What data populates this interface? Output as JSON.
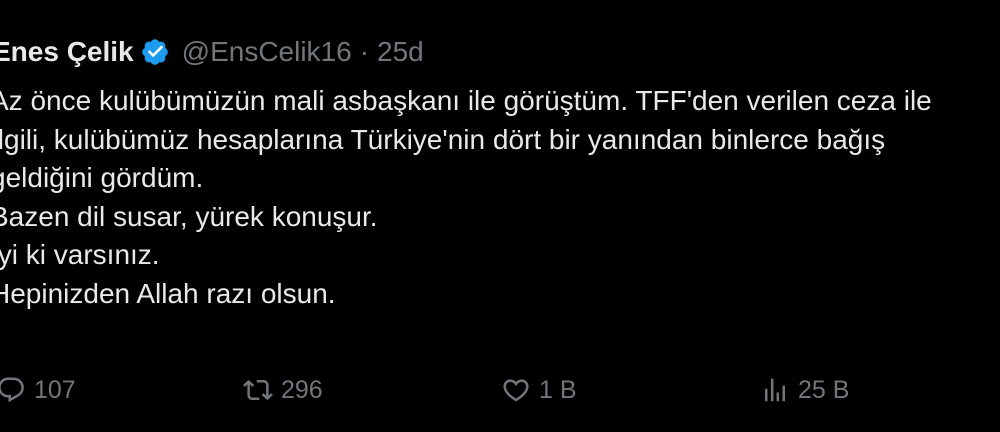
{
  "author": {
    "name": "Enes Çelik",
    "handle": "@EnsCelik16",
    "separator": "·",
    "time": "25d"
  },
  "body_lines": [
    "Az önce kulübümüzün mali asbaşkanı ile görüştüm. TFF'den verilen ceza ile",
    "İlgili, kulübümüz hesaplarına Türkiye'nin dört bir yanından binlerce bağış",
    "geldiğini gördüm.",
    "Bazen dil susar, yürek konuşur.",
    "İyi ki varsınız.",
    "Hepinizden Allah razı olsun."
  ],
  "actions": {
    "replies": "107",
    "retweets": "296",
    "likes": "1 B",
    "views": "25 B"
  },
  "colors": {
    "background": "#000000",
    "text": "#e7e9ea",
    "muted": "#71767b",
    "verified_badge": "#1d9bf0"
  },
  "icons": {
    "verified": "verified-badge-icon",
    "reply": "reply-icon",
    "retweet": "retweet-icon",
    "like": "heart-icon",
    "views": "views-chart-icon"
  }
}
